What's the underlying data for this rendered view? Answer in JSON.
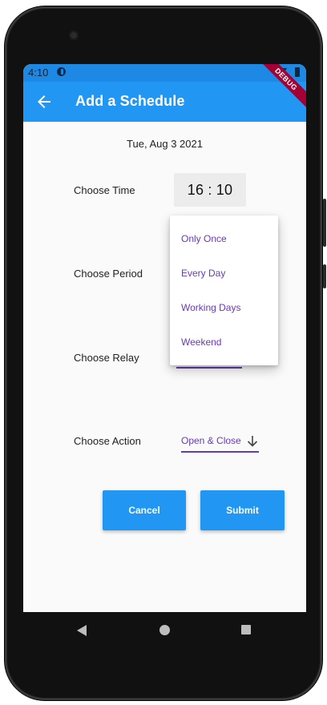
{
  "status": {
    "time": "4:10"
  },
  "appbar": {
    "title": "Add a Schedule"
  },
  "debug": {
    "label": "DEBUG"
  },
  "form": {
    "date": "Tue, Aug 3 2021",
    "labels": {
      "time": "Choose Time",
      "period": "Choose Period",
      "relay": "Choose Relay",
      "action": "Choose Action"
    },
    "time_value": "16 : 10",
    "action_value": "Open & Close"
  },
  "period_menu": {
    "options": [
      "Only Once",
      "Every Day",
      "Working Days",
      "Weekend"
    ]
  },
  "buttons": {
    "cancel": "Cancel",
    "submit": "Submit"
  },
  "colors": {
    "primary": "#2196f3",
    "accent": "#673ab7",
    "status_bar": "#1e88e5"
  }
}
